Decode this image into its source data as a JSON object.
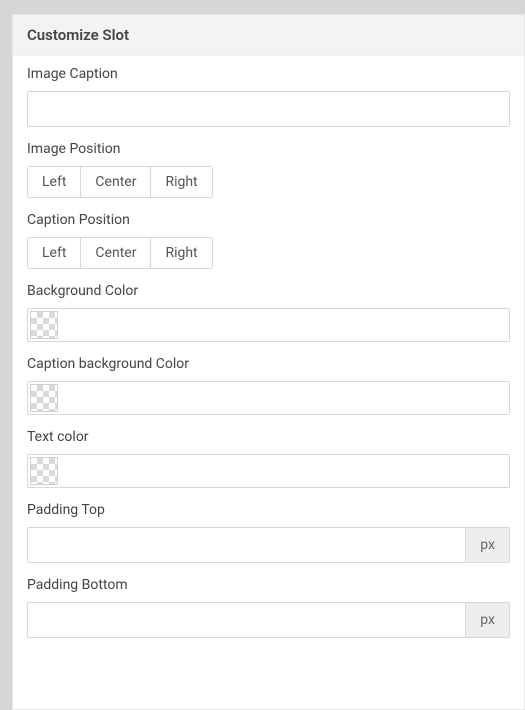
{
  "panel": {
    "title": "Customize Slot"
  },
  "fields": {
    "imageCaption": {
      "label": "Image Caption",
      "value": ""
    },
    "imagePosition": {
      "label": "Image Position",
      "options": [
        "Left",
        "Center",
        "Right"
      ]
    },
    "captionPosition": {
      "label": "Caption Position",
      "options": [
        "Left",
        "Center",
        "Right"
      ]
    },
    "backgroundColor": {
      "label": "Background Color",
      "value": ""
    },
    "captionBackgroundColor": {
      "label": "Caption background Color",
      "value": ""
    },
    "textColor": {
      "label": "Text color",
      "value": ""
    },
    "paddingTop": {
      "label": "Padding Top",
      "value": "",
      "unit": "px"
    },
    "paddingBottom": {
      "label": "Padding Bottom",
      "value": "",
      "unit": "px"
    }
  }
}
